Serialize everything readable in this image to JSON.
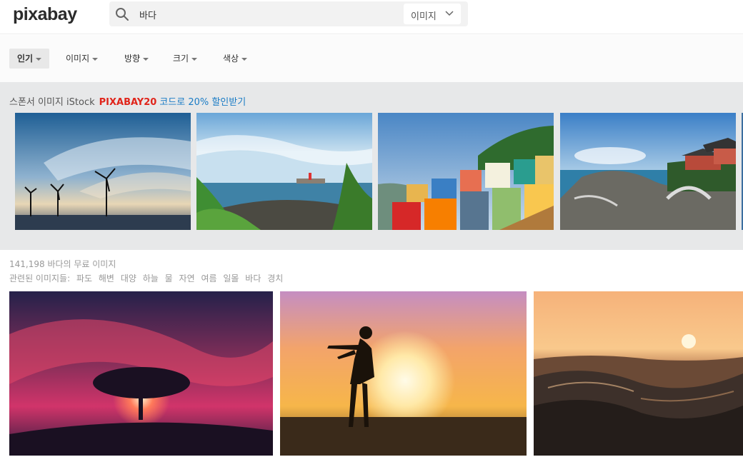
{
  "header": {
    "logo": "pixabay",
    "search": {
      "value": "바다",
      "icon": "search-icon"
    },
    "type_dropdown": {
      "label": "이미지",
      "icon": "chevron-down-icon"
    }
  },
  "filters": [
    {
      "label": "인기",
      "active": true
    },
    {
      "label": "이미지",
      "active": false
    },
    {
      "label": "방향",
      "active": false
    },
    {
      "label": "크기",
      "active": false
    },
    {
      "label": "색상",
      "active": false
    }
  ],
  "sponsored": {
    "prefix": "스폰서 이미지 iStock",
    "code": "PIXABAY20",
    "link_text": "코드로 20% 할인받기",
    "images": [
      {
        "icon": "wind-turbines-photo"
      },
      {
        "icon": "coastal-rocks-lighthouse-photo"
      },
      {
        "icon": "colorful-hillside-village-photo"
      },
      {
        "icon": "seaside-temple-photo"
      }
    ]
  },
  "results": {
    "count_text": "141,198 바다의 무료 이미지",
    "related_label": "관련된 이미지들:",
    "related_terms": [
      "파도",
      "해변",
      "대양",
      "하늘",
      "물",
      "자연",
      "여름",
      "일몰",
      "바다",
      "경치"
    ],
    "images": [
      {
        "icon": "tree-sunset-photo"
      },
      {
        "icon": "woman-silhouette-sunset-photo"
      },
      {
        "icon": "ocean-waves-sunset-photo"
      }
    ]
  },
  "colors": {
    "code_red": "#e0251b",
    "link_blue": "#1b7cc5",
    "sponsored_bg": "#e7e8e9"
  }
}
